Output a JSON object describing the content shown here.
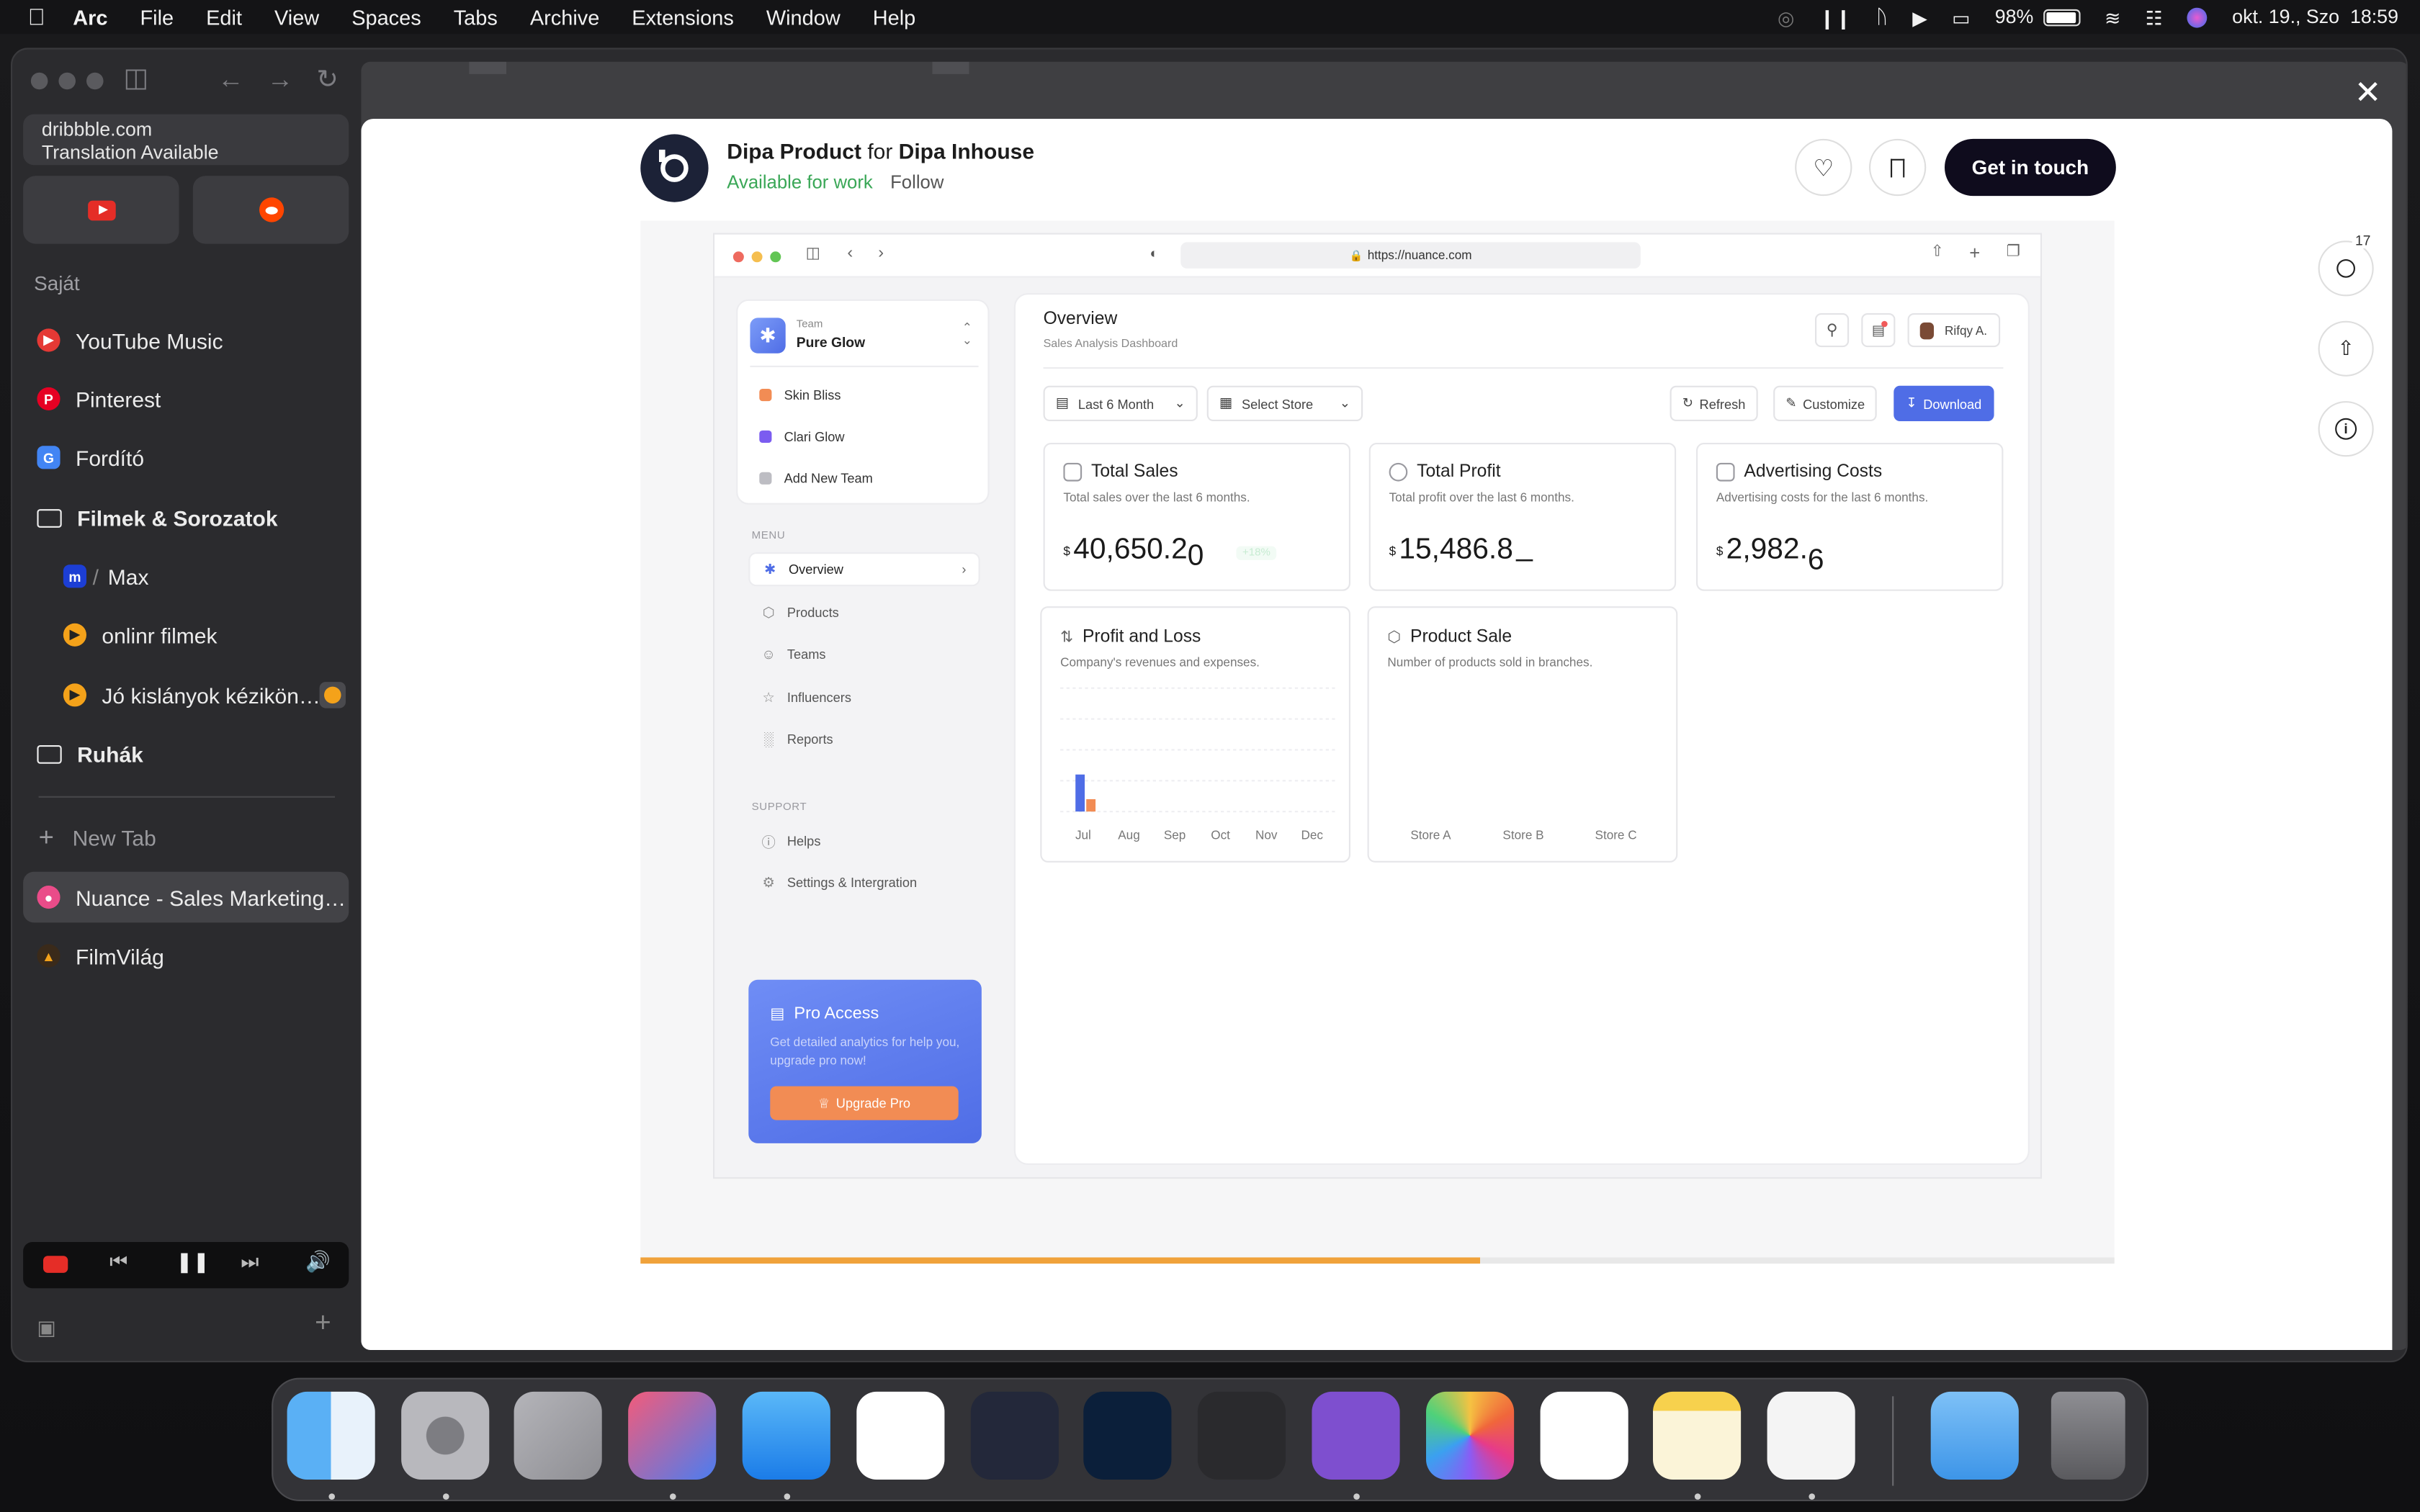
{
  "menubar": {
    "app": "Arc",
    "items": [
      "File",
      "Edit",
      "View",
      "Spaces",
      "Tabs",
      "Archive",
      "Extensions",
      "Window",
      "Help"
    ],
    "battery": "98%",
    "datetime": "okt. 19., Szo  18:59"
  },
  "sidebar": {
    "url_domain": "dribbble.com",
    "url_note": "Translation Available",
    "favorites": [
      "youtube-icon",
      "reddit-icon"
    ],
    "section_label": "Saját",
    "items": [
      {
        "label": "YouTube Music",
        "icon": "youtube-music-icon",
        "color": "#e53935"
      },
      {
        "label": "Pinterest",
        "icon": "pinterest-icon",
        "color": "#e60023"
      },
      {
        "label": "Fordító",
        "icon": "translate-icon",
        "color": "#4285f4"
      },
      {
        "label": "Filmek & Sorozatok",
        "icon": "folder-open-icon",
        "color": "#ffffff"
      },
      {
        "label": "Max",
        "icon": "max-icon",
        "color": "#1c3ed4"
      },
      {
        "label": "onlinr filmek",
        "icon": "play-icon",
        "color": "#f4a21a"
      },
      {
        "label": "Jó kislányok kézikön…",
        "icon": "play-icon",
        "color": "#f4a21a"
      },
      {
        "label": "Ruhák",
        "icon": "folder-icon",
        "color": "#ffffff"
      }
    ],
    "new_tab": "New Tab",
    "tabs": [
      {
        "label": "Nuance - Sales Marketing…",
        "icon": "dribbble-icon"
      },
      {
        "label": "FilmVilág",
        "icon": "filmvilag-icon"
      }
    ]
  },
  "shot_header": {
    "title_name": "Dipa Product",
    "title_for": "for",
    "title_team": "Dipa Inhouse",
    "available": "Available for work",
    "follow": "Follow",
    "cta": "Get in touch",
    "comment_count": "17"
  },
  "colors": {
    "available": "#3aa757",
    "cta": "#0f0c1d",
    "progress": "#f0a23b",
    "accent": "#4f6de6",
    "orange": "#f28c54"
  },
  "progress": {
    "fraction": 0.57
  },
  "inner": {
    "url": "https://nuance.com",
    "team_label": "Team",
    "team_name": "Pure Glow",
    "teams": [
      {
        "label": "Skin Bliss",
        "color": "#f28c54"
      },
      {
        "label": "Clari Glow",
        "color": "#7b5cf0"
      },
      {
        "label": "Add New Team",
        "color": "#bdbdc3"
      }
    ],
    "menu_label": "MENU",
    "menu": [
      "Overview",
      "Products",
      "Teams",
      "Influencers",
      "Reports"
    ],
    "support_label": "SUPPORT",
    "support": [
      "Helps",
      "Settings & Intergration"
    ],
    "pro_title": "Pro Access",
    "pro_text": "Get detailed analytics for help you, upgrade pro now!",
    "pro_button": "Upgrade Pro",
    "page_title": "Overview",
    "page_subtitle": "Sales Analysis Dashboard",
    "user": "Rifqy A.",
    "filter1": "Last 6 Month",
    "filter2": "Select Store",
    "btn_refresh": "Refresh",
    "btn_customize": "Customize",
    "btn_download": "Download",
    "kpis": [
      {
        "title": "Total Sales",
        "desc": "Total sales over the last 6 months.",
        "currency": "$",
        "value": "40,650.2",
        "tail": "0",
        "badge": "+18%"
      },
      {
        "title": "Total Profit",
        "desc": "Total profit over the last 6 months.",
        "currency": "$",
        "value": "15,486.8",
        "tail": "_",
        "badge": ""
      },
      {
        "title": "Advertising Costs",
        "desc": "Advertising costs for the last 6 months.",
        "currency": "$",
        "value": "2,982.",
        "tail": "6",
        "badge": ""
      }
    ],
    "pl_title": "Profit and Loss",
    "pl_desc": "Company's revenues and expenses.",
    "ps_title": "Product Sale",
    "ps_desc": "Number of products sold in branches."
  },
  "chart_data": [
    {
      "type": "bar",
      "title": "Profit and Loss",
      "categories": [
        "Jul",
        "Aug",
        "Sep",
        "Oct",
        "Nov",
        "Dec"
      ],
      "series": [
        {
          "values": [
            0.3,
            null,
            null,
            null,
            null,
            null
          ]
        },
        {
          "values": [
            0.1,
            null,
            null,
            null,
            null,
            null
          ]
        }
      ],
      "ylim": [
        0,
        1
      ],
      "grid": true
    },
    {
      "type": "bar",
      "title": "Product Sale",
      "categories": [
        "Store A",
        "Store B",
        "Store C"
      ],
      "series": []
    }
  ]
}
